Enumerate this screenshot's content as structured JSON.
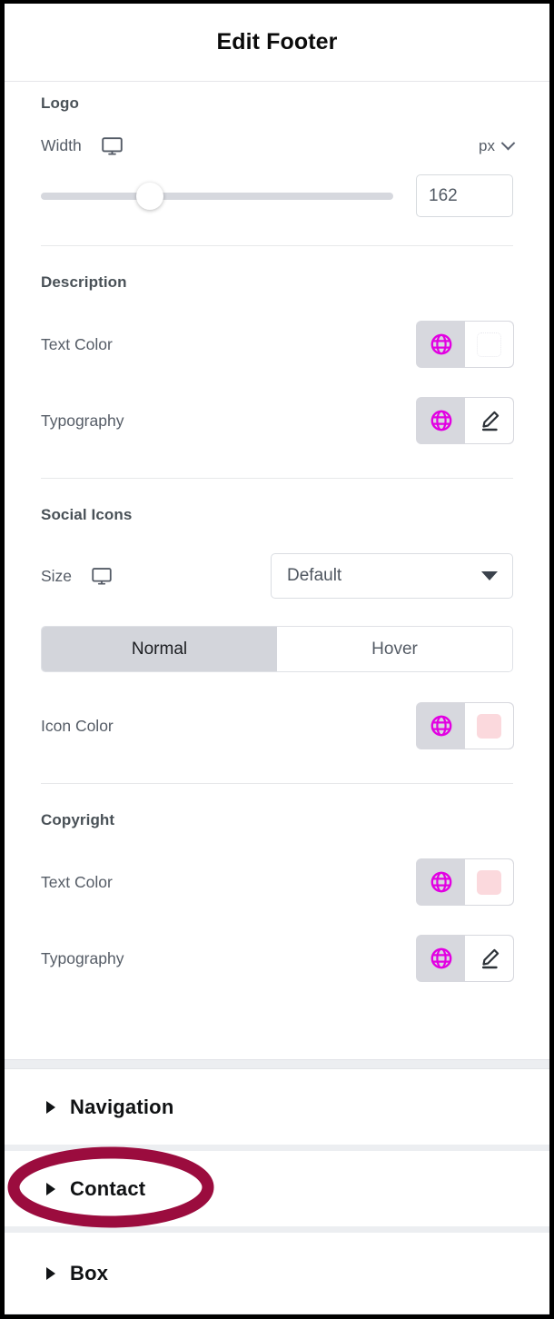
{
  "header": {
    "title": "Edit Footer"
  },
  "colors": {
    "globe_icon": "#e200e2",
    "swatch_pink": "#fbd9dd",
    "annotation": "#9b0c3e",
    "control_bg": "#d7d8de",
    "tab_active_bg": "#d3d5db",
    "slider_track": "#d6d8de",
    "heading_text": "#495157",
    "label_text": "#555c66"
  },
  "sections": [
    {
      "heading": "Logo",
      "width_row": {
        "label": "Width",
        "device_icon": "desktop-monitor-icon",
        "unit": "px",
        "unit_chevron": "chevron-down-icon"
      },
      "slider": {
        "value": "162",
        "percent": 31,
        "min": 0,
        "max": 500
      }
    },
    {
      "heading": "Description",
      "rows": [
        {
          "label": "Text Color",
          "control": "color-picker",
          "globe_icon": "globe-icon",
          "swatch": "none"
        },
        {
          "label": "Typography",
          "control": "typography-editor",
          "globe_icon": "globe-icon",
          "edit_icon": "pencil-icon"
        }
      ]
    },
    {
      "heading": "Social Icons",
      "size_row": {
        "label": "Size",
        "device_icon": "desktop-monitor-icon",
        "dropdown_value": "Default",
        "dropdown_caret": "caret-down-icon"
      },
      "tabs": [
        {
          "label": "Normal",
          "active": true
        },
        {
          "label": "Hover",
          "active": false
        }
      ],
      "rows": [
        {
          "label": "Icon Color",
          "control": "color-picker",
          "globe_icon": "globe-icon",
          "swatch": "#fbd9dd"
        }
      ]
    },
    {
      "heading": "Copyright",
      "rows": [
        {
          "label": "Text Color",
          "control": "color-picker",
          "globe_icon": "globe-icon",
          "swatch": "#fbd9dd"
        },
        {
          "label": "Typography",
          "control": "typography-editor",
          "globe_icon": "globe-icon",
          "edit_icon": "pencil-icon"
        }
      ]
    }
  ],
  "accordion": [
    {
      "label": "Navigation",
      "arrow": "triangle-right-icon",
      "expanded": false,
      "annotated": false
    },
    {
      "label": "Contact",
      "arrow": "triangle-right-icon",
      "expanded": false,
      "annotated": true
    },
    {
      "label": "Box",
      "arrow": "triangle-right-icon",
      "expanded": false,
      "annotated": false
    }
  ]
}
